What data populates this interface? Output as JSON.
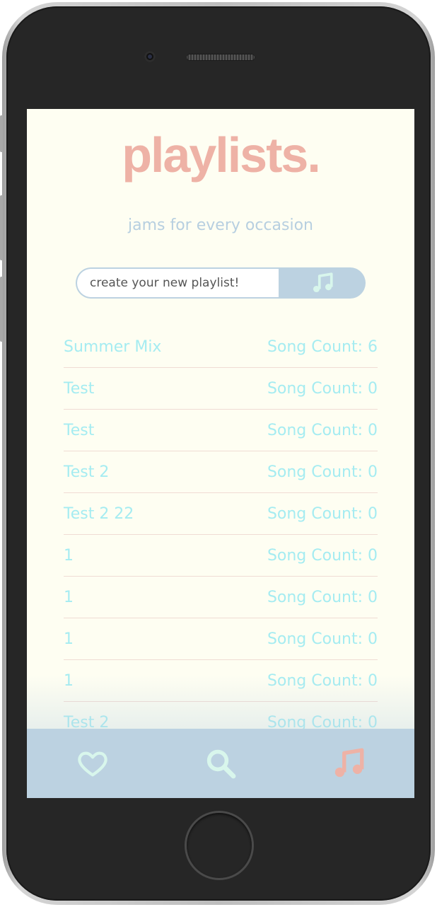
{
  "app": {
    "title": "playlists.",
    "subtitle": "jams for every occasion"
  },
  "create": {
    "placeholder": "create your new playlist!",
    "submit_icon": "music-note-icon"
  },
  "playlists": [
    {
      "name": "Summer Mix",
      "count_label": "Song Count: 6"
    },
    {
      "name": "Test",
      "count_label": "Song Count: 0"
    },
    {
      "name": "Test",
      "count_label": "Song Count: 0"
    },
    {
      "name": "Test 2",
      "count_label": "Song Count: 0"
    },
    {
      "name": "Test 2 22",
      "count_label": "Song Count: 0"
    },
    {
      "name": "1",
      "count_label": "Song Count: 0"
    },
    {
      "name": "1",
      "count_label": "Song Count: 0"
    },
    {
      "name": "1",
      "count_label": "Song Count: 0"
    },
    {
      "name": "1",
      "count_label": "Song Count: 0"
    },
    {
      "name": "Test 2",
      "count_label": "Song Count: 0"
    }
  ],
  "nav": {
    "items": [
      {
        "icon": "heart-icon",
        "active": false
      },
      {
        "icon": "search-icon",
        "active": false
      },
      {
        "icon": "music-note-icon",
        "active": true
      }
    ]
  },
  "colors": {
    "background": "#fefef2",
    "accent_pink": "#eeb2a6",
    "accent_blue": "#bcd2e1",
    "text_cyan": "#a5ecf1",
    "icon_mint": "#d8f6ec"
  }
}
